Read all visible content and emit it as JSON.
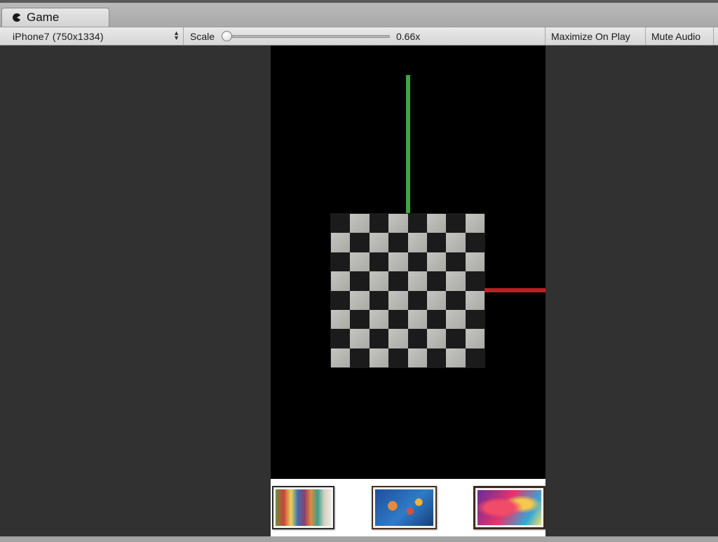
{
  "tab": {
    "title": "Game",
    "icon": "pacman-icon"
  },
  "toolbar": {
    "resolution": "iPhone7 (750x1334)",
    "scale_label": "Scale",
    "scale_value": "0.66x",
    "scale_fraction": 0.0,
    "maximize_label": "Maximize On Play",
    "mute_label": "Mute Audio"
  },
  "scene": {
    "board": {
      "rows": 8,
      "cols": 8
    },
    "axis_colors": {
      "y": "#3ea641",
      "x": "#c21d24"
    }
  },
  "thumbnails": [
    {
      "name": "painting-thumbnail-street"
    },
    {
      "name": "painting-thumbnail-fish"
    },
    {
      "name": "painting-thumbnail-abstract"
    }
  ]
}
